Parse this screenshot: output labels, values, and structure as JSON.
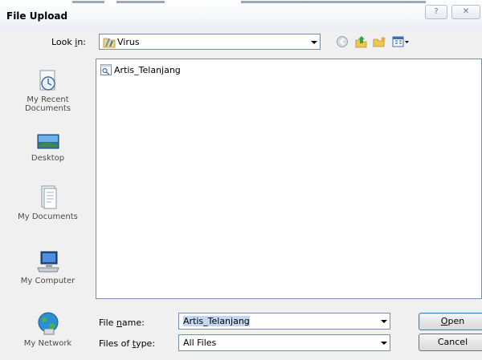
{
  "window": {
    "title": "File Upload",
    "help_label": "?",
    "close_label": "✕"
  },
  "toolbar": {
    "look_in_label_pre": "Look ",
    "look_in_label_key": "i",
    "look_in_label_post": "n:",
    "look_in_value": "Virus",
    "buttons": [
      "back-icon",
      "up-folder-icon",
      "new-folder-icon",
      "views-menu-icon"
    ]
  },
  "places": [
    {
      "label": "My Recent\nDocuments",
      "icon": "recent-documents-icon"
    },
    {
      "label": "Desktop",
      "icon": "desktop-icon"
    },
    {
      "label": "My Documents",
      "icon": "my-documents-icon"
    },
    {
      "label": "My Computer",
      "icon": "my-computer-icon"
    },
    {
      "label": "My Network",
      "icon": "network-icon"
    }
  ],
  "files": [
    {
      "name": "Artis_Telanjang",
      "icon": "file-icon"
    }
  ],
  "file_name": {
    "label_pre": "File ",
    "label_key": "n",
    "label_post": "ame:",
    "value": "Artis_Telanjang"
  },
  "file_type": {
    "label_pre": "Files of ",
    "label_key": "t",
    "label_post": "ype:",
    "value": "All Files"
  },
  "buttons": {
    "open_key": "O",
    "open_rest": "pen",
    "cancel": "Cancel"
  },
  "colors": {
    "accent": "#3c7fb1",
    "selection": "#c4d7ee"
  }
}
